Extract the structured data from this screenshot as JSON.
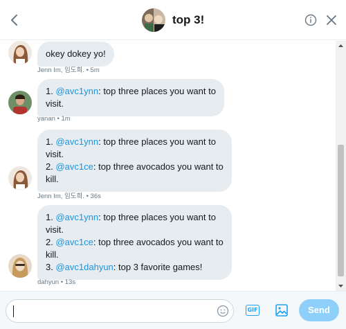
{
  "header": {
    "title": "top 3!"
  },
  "messages": [
    {
      "lines": [
        {
          "text": "okey dokey yo!"
        }
      ],
      "meta": "Jenn Im, 임도희. • 5m"
    },
    {
      "lines": [
        {
          "prefix": "1. ",
          "mention": "@avc1ynn",
          "suffix": ": top three places you want to"
        },
        {
          "text": "visit."
        }
      ],
      "meta": "yanan • 1m"
    },
    {
      "lines": [
        {
          "prefix": "1. ",
          "mention": "@avc1ynn",
          "suffix": ": top three places you want to"
        },
        {
          "text": "visit."
        },
        {
          "prefix": "2. ",
          "mention": "@avc1ce",
          "suffix": ": top three avocados you want to"
        },
        {
          "text": "kill."
        }
      ],
      "meta": "Jenn Im, 임도희. • 36s"
    },
    {
      "lines": [
        {
          "prefix": "1. ",
          "mention": "@avc1ynn",
          "suffix": ": top three places you want to"
        },
        {
          "text": "visit."
        },
        {
          "prefix": "2. ",
          "mention": "@avc1ce",
          "suffix": ": top three avocados you want to"
        },
        {
          "text": "kill."
        },
        {
          "prefix": "3. ",
          "mention": "@avc1dahyun",
          "suffix": ": top 3 favorite games!"
        }
      ],
      "meta": "dahyun • 13s"
    }
  ],
  "composer": {
    "input_value": "",
    "gif_label": "GIF",
    "send_label": "Send"
  },
  "icons": {
    "back": "chevron-left-icon",
    "info": "info-icon",
    "close": "close-icon",
    "emoji": "emoji-icon",
    "gif": "gif-icon",
    "photo": "image-icon"
  },
  "colors": {
    "accent": "#1da1f2",
    "mention": "#1b95e0",
    "bubble": "#e6ecf0",
    "send_disabled": "#8ed0f9",
    "meta_text": "#657786"
  }
}
